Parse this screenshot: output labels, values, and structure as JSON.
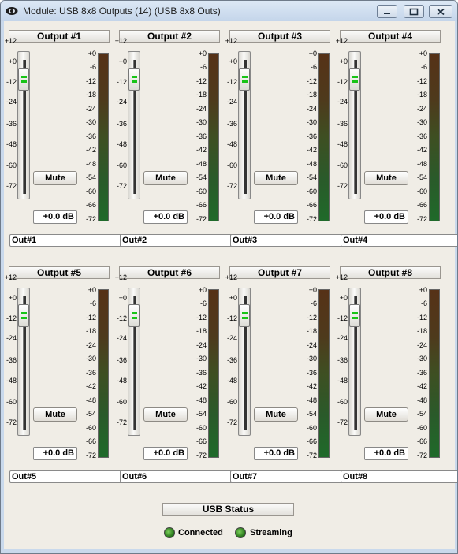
{
  "window": {
    "title": "Module: USB 8x8 Outputs (14) (USB 8x8 Outs)"
  },
  "fader_scale": [
    "+12",
    "+0",
    "-12",
    "-24",
    "-36",
    "-48",
    "-60",
    "-72"
  ],
  "meter_scale": [
    "+0",
    "-6",
    "-12",
    "-18",
    "-24",
    "-30",
    "-36",
    "-42",
    "-48",
    "-54",
    "-60",
    "-66",
    "-72"
  ],
  "outputs": [
    {
      "label": "Output #1",
      "mute_label": "Mute",
      "gain": "+0.0 dB",
      "name": "Out#1",
      "fader_level_db": 0
    },
    {
      "label": "Output #2",
      "mute_label": "Mute",
      "gain": "+0.0 dB",
      "name": "Out#2",
      "fader_level_db": 0
    },
    {
      "label": "Output #3",
      "mute_label": "Mute",
      "gain": "+0.0 dB",
      "name": "Out#3",
      "fader_level_db": 0
    },
    {
      "label": "Output #4",
      "mute_label": "Mute",
      "gain": "+0.0 dB",
      "name": "Out#4",
      "fader_level_db": 0
    },
    {
      "label": "Output #5",
      "mute_label": "Mute",
      "gain": "+0.0 dB",
      "name": "Out#5",
      "fader_level_db": 0
    },
    {
      "label": "Output #6",
      "mute_label": "Mute",
      "gain": "+0.0 dB",
      "name": "Out#6",
      "fader_level_db": 0
    },
    {
      "label": "Output #7",
      "mute_label": "Mute",
      "gain": "+0.0 dB",
      "name": "Out#7",
      "fader_level_db": 0
    },
    {
      "label": "Output #8",
      "mute_label": "Mute",
      "gain": "+0.0 dB",
      "name": "Out#8",
      "fader_level_db": 0
    }
  ],
  "usb_status": {
    "label": "USB Status",
    "connected_label": "Connected",
    "streaming_label": "Streaming"
  },
  "colors": {
    "led_on": "#18c418",
    "meter_top": "#563217",
    "meter_bottom": "#1f6a2a"
  }
}
